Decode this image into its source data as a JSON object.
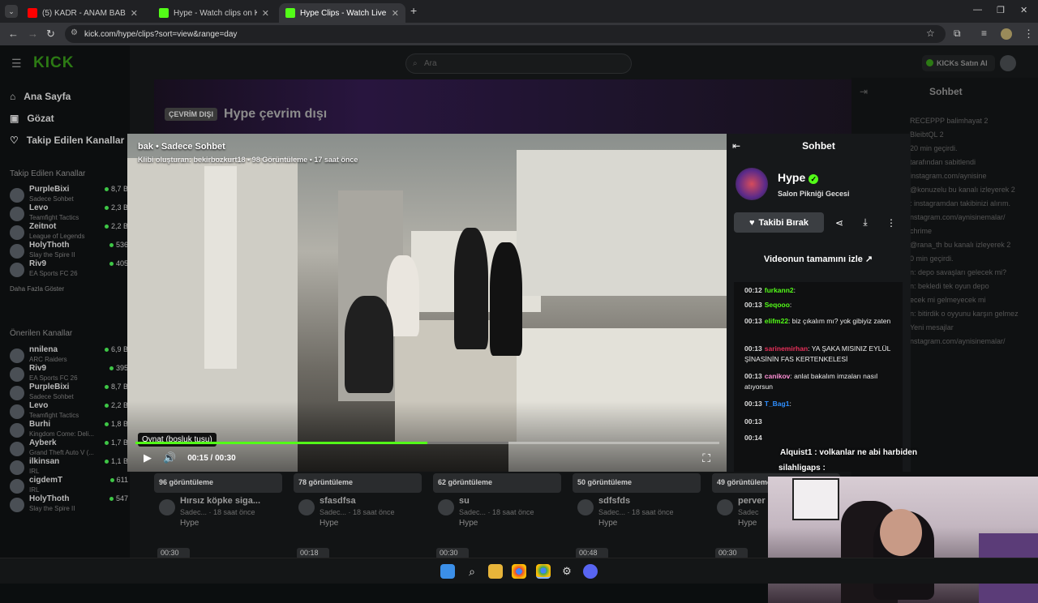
{
  "browser": {
    "tabs": [
      {
        "title": "(5) KADR - ANAM BABAM (Offi",
        "fav_color": "#ff0000"
      },
      {
        "title": "Hype - Watch clips on Kick",
        "fav_color": "#53fc18"
      },
      {
        "title": "Hype Clips - Watch Live on Kick",
        "fav_color": "#53fc18"
      }
    ],
    "new_tab": "+",
    "url": "kick.com/hype/clips?sort=view&range=day"
  },
  "kick": {
    "logo": "KICK",
    "search_placeholder": "Ara",
    "promo_button": "KICKs Satın Al"
  },
  "sidebar": {
    "nav": [
      {
        "label": "Ana Sayfa",
        "icon": "home-icon"
      },
      {
        "label": "Gözat",
        "icon": "browse-icon"
      },
      {
        "label": "Takip Edilen Kanallar",
        "icon": "heart-icon"
      }
    ],
    "followed_title": "Takip Edilen Kanallar",
    "followed": [
      {
        "name": "PurpleBixi",
        "game": "Sadece Sohbet",
        "count": "8,7 B"
      },
      {
        "name": "Levo",
        "game": "Teamfight Tactics",
        "count": "2,3 B"
      },
      {
        "name": "Zeitnot",
        "game": "League of Legends",
        "count": "2,2 B"
      },
      {
        "name": "HolyThoth",
        "game": "Slay the Spire II",
        "count": "536"
      },
      {
        "name": "Riv9",
        "game": "EA Sports FC 26",
        "count": "405"
      }
    ],
    "show_more": "Daha Fazla Göster",
    "recommended_title": "Önerilen Kanallar",
    "recommended": [
      {
        "name": "nnilena",
        "game": "ARC Raiders",
        "count": "6,9 B"
      },
      {
        "name": "Riv9",
        "game": "EA Sports FC 26",
        "count": "395"
      },
      {
        "name": "PurpleBixi",
        "game": "Sadece Sohbet",
        "count": "8,7 B"
      },
      {
        "name": "Levo",
        "game": "Teamfight Tactics",
        "count": "2,2 B"
      },
      {
        "name": "Burhi",
        "game": "Kingdom Come: Deli...",
        "count": "1,8 B"
      },
      {
        "name": "Ayberk",
        "game": "Grand Theft Auto V (...",
        "count": "1,7 B"
      },
      {
        "name": "ilkinsan",
        "game": "IRL",
        "count": "1,1 B"
      },
      {
        "name": "cigdemT",
        "game": "IRL",
        "count": "611"
      },
      {
        "name": "HolyThoth",
        "game": "Slay the Spire II",
        "count": "547"
      }
    ]
  },
  "channel": {
    "offline_badge": "ÇEVRİM DIŞI",
    "offline_title": "Hype çevrim dışı"
  },
  "clips": [
    {
      "views": "96 görüntüleme",
      "title": "Hırsız köpke siga...",
      "meta": "Sadec... · 18 saat önce",
      "owner": "Hype"
    },
    {
      "views": "78 görüntüleme",
      "title": "sfasdfsa",
      "meta": "Sadec... · 18 saat önce",
      "owner": "Hype"
    },
    {
      "views": "62 görüntüleme",
      "title": "su",
      "meta": "Sadec... · 18 saat önce",
      "owner": "Hype"
    },
    {
      "views": "50 görüntüleme",
      "title": "sdfsfds",
      "meta": "Sadec... · 18 saat önce",
      "owner": "Hype"
    },
    {
      "views": "49 görüntüleme",
      "title": "perver",
      "meta": "Sadec",
      "owner": "Hype"
    }
  ],
  "clip_durations": [
    "00:30",
    "00:18",
    "00:30",
    "00:48",
    "00:30"
  ],
  "modal": {
    "title": "bak • Sadece Sohbet",
    "sub_prefix": "Klibi oluşturan: ",
    "creator": "bekirbozkurt18",
    "sub_suffix": " • 98 Görüntüleme • 17 saat önce",
    "tooltip": "Oynat (boşluk tuşu)",
    "time": "00:15 / 00:30",
    "progress": 0.5,
    "chat_header": "Sohbet",
    "channel_name": "Hype",
    "channel_desc": "Salon Pikniği Gecesi",
    "follow_label": "Takibi Bırak",
    "watch_full": "Videonun tamamını izle ↗"
  },
  "messages": [
    {
      "time": "00:12",
      "user": "furkann2",
      "color": "#53fc18",
      "text": ""
    },
    {
      "time": "00:13",
      "user": "Seqooo",
      "color": "#53fc18",
      "text": ""
    },
    {
      "time": "00:13",
      "user": "elifm22",
      "color": "#53fc18",
      "text": "biz çıkalım mı? yok gibiyiz zaten"
    },
    {
      "time": "00:13",
      "user": "sarinemirhan",
      "color": "#e8305a",
      "text": "YA ŞAKA MISINIZ EYLÜL ŞİNASİNİN FAS KERTENKELESİ"
    },
    {
      "time": "00:13",
      "user": "canikov",
      "color": "#ff8fd6",
      "text": "anlat bakalım imzaları nasıl atıyorsun"
    },
    {
      "time": "00:13",
      "user": "T_Bag1",
      "color": "#2f8fff",
      "text": ""
    },
    {
      "time": "00:13",
      "user": "",
      "color": "#2f8fff",
      "text": ""
    },
    {
      "time": "00:14",
      "user": "",
      "color": "#2f8fff",
      "text": ""
    }
  ],
  "overlay": {
    "alq": "Alquist1 : volkanlar ne abi harbiden",
    "sil": "silahligaps :"
  },
  "right_chat": {
    "header": "Sohbet",
    "lines": [
      "RECEPPP    balimhayat 2",
      "BleibtQL 2",
      "20 min geçirdi.",
      "tarafından sabitlendi",
      "instagram.com/aynisine",
      "@konuzelu bu kanalı izleyerek 2",
      ": instagramdan takibinizi alırım.",
      "nstagram.com/aynisinemalar/",
      "chrime",
      "@rana_th bu kanalı izleyerek 2",
      "0 min geçirdi.",
      "n: depo savaşları gelecek mi?",
      "n: bekledi tek oyun depo",
      "ecek mi gelmeyecek mi",
      "n: bitirdik o oyyunu karşın gelmez",
      "Yeni mesajlar",
      "nstagram.com/aynisinemalar/"
    ]
  },
  "colors": {
    "accent": "#53fc18",
    "bg": "#0d0f10"
  }
}
